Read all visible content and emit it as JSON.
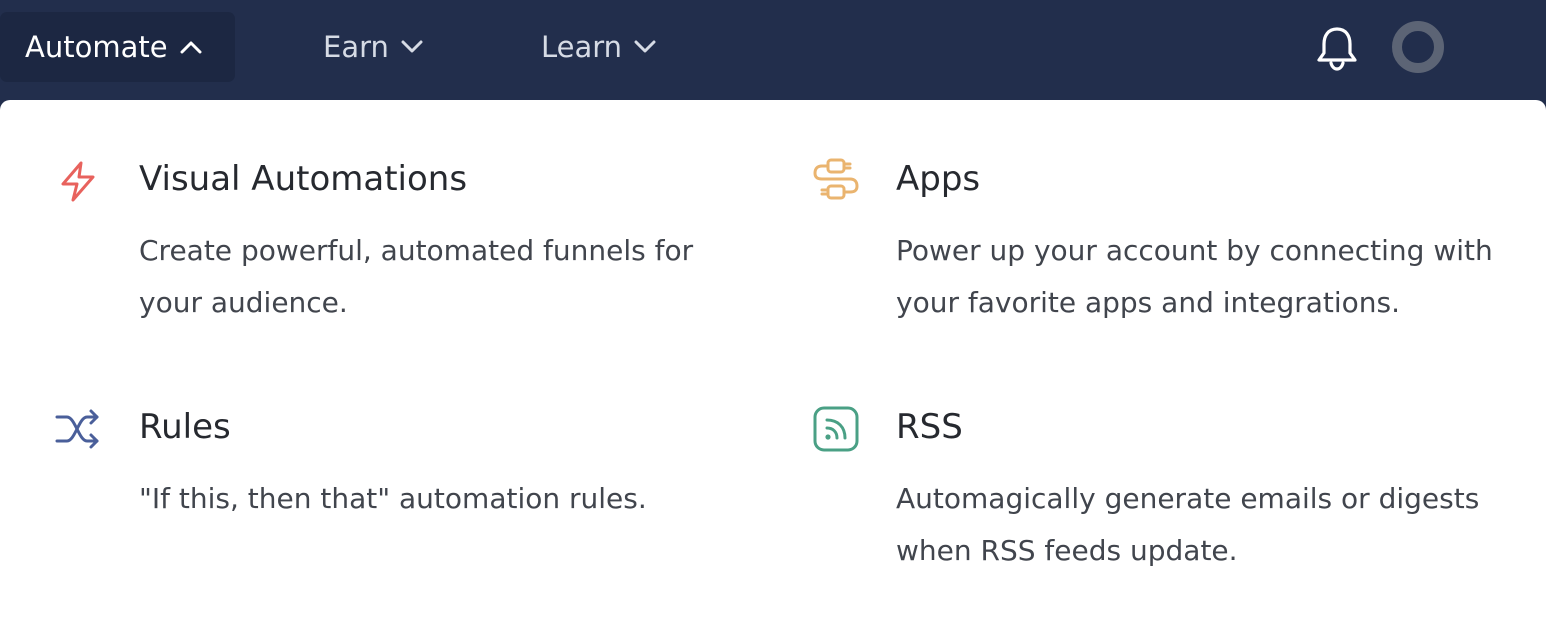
{
  "nav": {
    "items": [
      {
        "label": "Automate",
        "expanded": true
      },
      {
        "label": "Earn",
        "expanded": false
      },
      {
        "label": "Learn",
        "expanded": false
      }
    ]
  },
  "icons": {
    "bell": "bell-icon",
    "avatar": "avatar"
  },
  "colors": {
    "topbar": "#222e4c",
    "visual_automations_icon": "#e8625d",
    "apps_icon": "#eab46f",
    "rules_icon": "#4a5f9a",
    "rss_icon": "#4aa085"
  },
  "menu": {
    "visual_automations": {
      "title": "Visual Automations",
      "description": "Create powerful, automated funnels for your audience.",
      "icon": "lightning-icon"
    },
    "apps": {
      "title": "Apps",
      "description": "Power up your account by connecting with your favorite apps and integrations.",
      "icon": "plug-icon"
    },
    "rules": {
      "title": "Rules",
      "description": "\"If this, then that\" automation rules.",
      "icon": "shuffle-icon"
    },
    "rss": {
      "title": "RSS",
      "description": "Automagically generate emails or digests when RSS feeds update.",
      "icon": "rss-icon"
    }
  }
}
